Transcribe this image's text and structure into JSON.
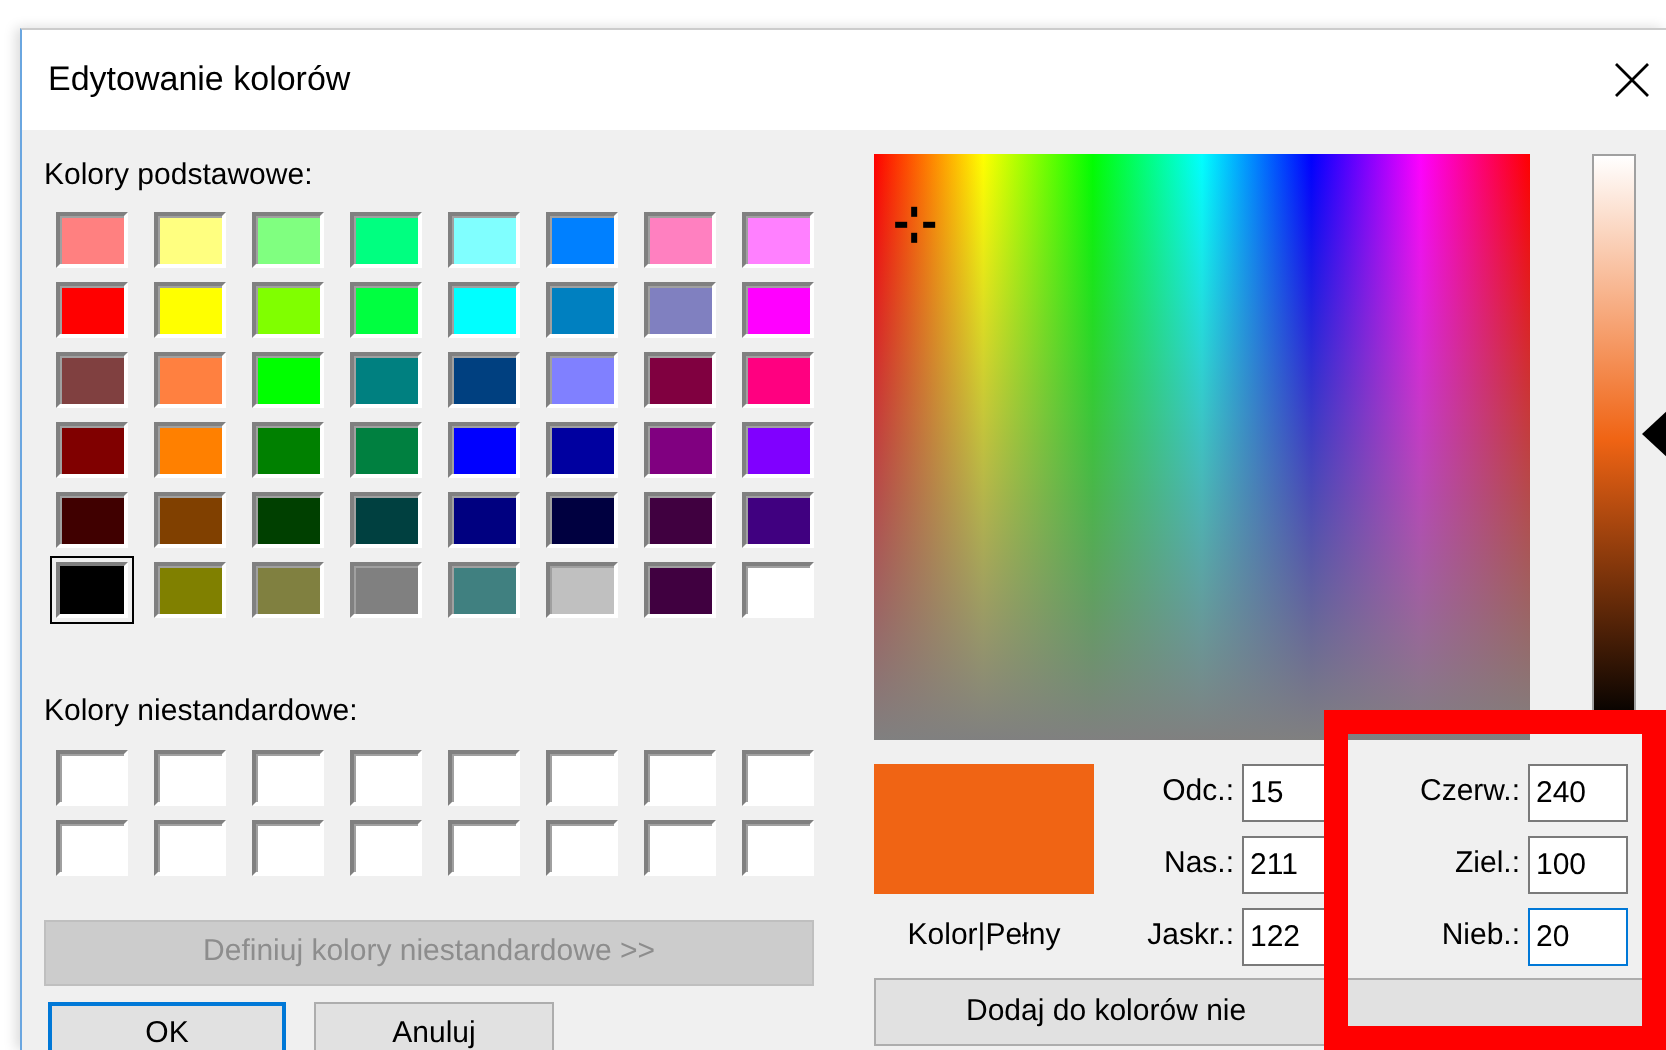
{
  "window": {
    "title": "Edytowanie kolorów"
  },
  "basic_colors": {
    "label": "Kolory podstawowe:",
    "swatches": [
      {
        "color": "#ff8080",
        "selected": false
      },
      {
        "color": "#ffff80",
        "selected": false
      },
      {
        "color": "#80ff80",
        "selected": false
      },
      {
        "color": "#00ff80",
        "selected": false
      },
      {
        "color": "#80ffff",
        "selected": false
      },
      {
        "color": "#0080ff",
        "selected": false
      },
      {
        "color": "#ff80c0",
        "selected": false
      },
      {
        "color": "#ff80ff",
        "selected": false
      },
      {
        "color": "#ff0000",
        "selected": false
      },
      {
        "color": "#ffff00",
        "selected": false
      },
      {
        "color": "#80ff00",
        "selected": false
      },
      {
        "color": "#00ff40",
        "selected": false
      },
      {
        "color": "#00ffff",
        "selected": false
      },
      {
        "color": "#0080c0",
        "selected": false
      },
      {
        "color": "#8080c0",
        "selected": false
      },
      {
        "color": "#ff00ff",
        "selected": false
      },
      {
        "color": "#804040",
        "selected": false
      },
      {
        "color": "#ff8040",
        "selected": false
      },
      {
        "color": "#00ff00",
        "selected": false
      },
      {
        "color": "#008080",
        "selected": false
      },
      {
        "color": "#004080",
        "selected": false
      },
      {
        "color": "#8080ff",
        "selected": false
      },
      {
        "color": "#800040",
        "selected": false
      },
      {
        "color": "#ff0080",
        "selected": false
      },
      {
        "color": "#800000",
        "selected": false
      },
      {
        "color": "#ff8000",
        "selected": false
      },
      {
        "color": "#008000",
        "selected": false
      },
      {
        "color": "#008040",
        "selected": false
      },
      {
        "color": "#0000ff",
        "selected": false
      },
      {
        "color": "#0000a0",
        "selected": false
      },
      {
        "color": "#800080",
        "selected": false
      },
      {
        "color": "#8000ff",
        "selected": false
      },
      {
        "color": "#400000",
        "selected": false
      },
      {
        "color": "#804000",
        "selected": false
      },
      {
        "color": "#004000",
        "selected": false
      },
      {
        "color": "#004040",
        "selected": false
      },
      {
        "color": "#000080",
        "selected": false
      },
      {
        "color": "#000040",
        "selected": false
      },
      {
        "color": "#400040",
        "selected": false
      },
      {
        "color": "#400080",
        "selected": false
      },
      {
        "color": "#000000",
        "selected": true
      },
      {
        "color": "#808000",
        "selected": false
      },
      {
        "color": "#808040",
        "selected": false
      },
      {
        "color": "#808080",
        "selected": false
      },
      {
        "color": "#408080",
        "selected": false
      },
      {
        "color": "#c0c0c0",
        "selected": false
      },
      {
        "color": "#400040",
        "selected": false
      },
      {
        "color": "#ffffff",
        "selected": false
      }
    ]
  },
  "custom_colors": {
    "label": "Kolory niestandardowe:",
    "swatches": [
      {
        "empty": true
      },
      {
        "empty": true
      },
      {
        "empty": true
      },
      {
        "empty": true
      },
      {
        "empty": true
      },
      {
        "empty": true
      },
      {
        "empty": true
      },
      {
        "empty": true
      },
      {
        "empty": true
      },
      {
        "empty": true
      },
      {
        "empty": true
      },
      {
        "empty": true
      },
      {
        "empty": true
      },
      {
        "empty": true
      },
      {
        "empty": true
      },
      {
        "empty": true
      }
    ]
  },
  "define_button": {
    "label": "Definiuj kolory niestandardowe >>",
    "disabled": true
  },
  "buttons": [
    {
      "label": "OK",
      "default": true
    },
    {
      "label": "Anuluj",
      "default": false
    }
  ],
  "luminance": {
    "level": 0.51
  },
  "preview": {
    "label": "Kolor|Pełny"
  },
  "hsl_fields": [
    {
      "label": "Odc.:",
      "value": "15",
      "focused": false
    },
    {
      "label": "Nas.:",
      "value": "211",
      "focused": false
    },
    {
      "label": "Jaskr.:",
      "value": "122",
      "focused": false
    }
  ],
  "rgb_fields": [
    {
      "label": "Czerw.:",
      "value": "240",
      "focused": false
    },
    {
      "label": "Ziel.:",
      "value": "100",
      "focused": false
    },
    {
      "label": "Nieb.:",
      "value": "20",
      "focused": true
    }
  ],
  "add_button": {
    "label": "Dodaj do kolorów nie"
  },
  "highlight": true
}
